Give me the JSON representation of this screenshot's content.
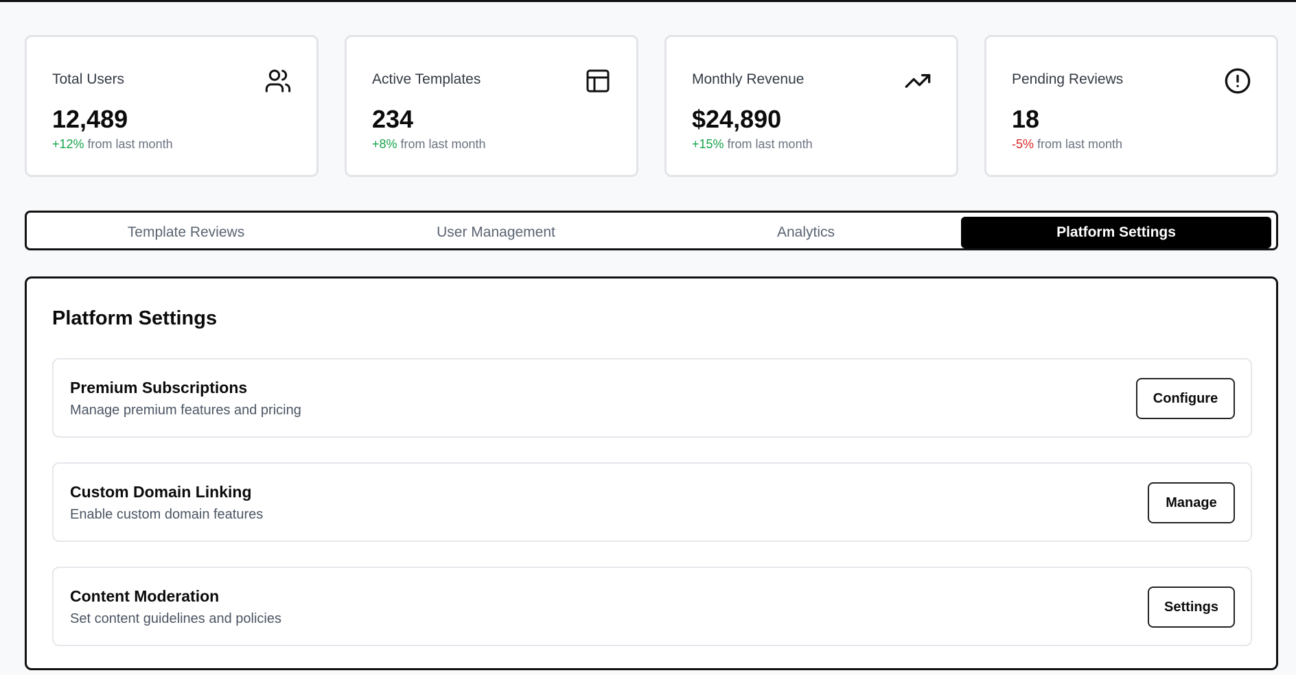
{
  "stats": [
    {
      "label": "Total Users",
      "value": "12,489",
      "change": "+12%",
      "change_suffix": " from last month",
      "icon": "users-icon"
    },
    {
      "label": "Active Templates",
      "value": "234",
      "change": "+8%",
      "change_suffix": " from last month",
      "icon": "layout-template-icon"
    },
    {
      "label": "Monthly Revenue",
      "value": "$24,890",
      "change": "+15%",
      "change_suffix": " from last month",
      "icon": "trending-up-icon"
    },
    {
      "label": "Pending Reviews",
      "value": "18",
      "change": "-5%",
      "change_suffix": " from last month",
      "icon": "alert-circle-icon"
    }
  ],
  "tabs": [
    {
      "label": "Template Reviews",
      "active": false
    },
    {
      "label": "User Management",
      "active": false
    },
    {
      "label": "Analytics",
      "active": false
    },
    {
      "label": "Platform Settings",
      "active": true
    }
  ],
  "panel": {
    "title": "Platform Settings",
    "settings": [
      {
        "title": "Premium Subscriptions",
        "description": "Manage premium features and pricing",
        "button": "Configure"
      },
      {
        "title": "Custom Domain Linking",
        "description": "Enable custom domain features",
        "button": "Manage"
      },
      {
        "title": "Content Moderation",
        "description": "Set content guidelines and policies",
        "button": "Settings"
      }
    ]
  },
  "colors": {
    "positive": "#16a34a",
    "negative": "#dc2626",
    "active_tab_bg": "#000000",
    "muted_text": "#6b7280"
  }
}
